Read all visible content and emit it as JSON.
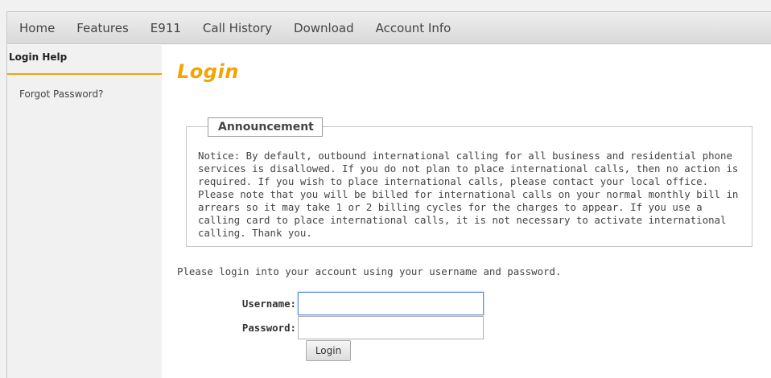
{
  "nav": {
    "items": [
      {
        "label": "Home"
      },
      {
        "label": "Features"
      },
      {
        "label": "E911"
      },
      {
        "label": "Call History"
      },
      {
        "label": "Download"
      },
      {
        "label": "Account Info"
      }
    ]
  },
  "sidebar": {
    "heading": "Login Help",
    "links": [
      {
        "label": "Forgot Password?"
      }
    ]
  },
  "main": {
    "title": "Login",
    "announcement": {
      "legend": "Announcement",
      "text": "Notice: By default, outbound international calling for all business and residential phone services is disallowed. If you do not plan to place international calls, then no action is required. If you wish to place international calls, please contact your local office. Please note that you will be billed for international calls on your normal monthly bill in arrears so it may take 1 or 2 billing cycles for the charges to appear. If you use a calling card to place international calls, it is not necessary to activate international calling. Thank you."
    },
    "intro": "Please login into your account using your username and password.",
    "form": {
      "username_label": "Username:",
      "username_value": "",
      "password_label": "Password:",
      "password_value": "",
      "submit_label": "Login"
    }
  },
  "colors": {
    "accent": "#f5a300",
    "nav_bg": "#e3e3e3",
    "sidebar_bg": "#f1f1f1",
    "input_focus": "#5b8fd8"
  }
}
